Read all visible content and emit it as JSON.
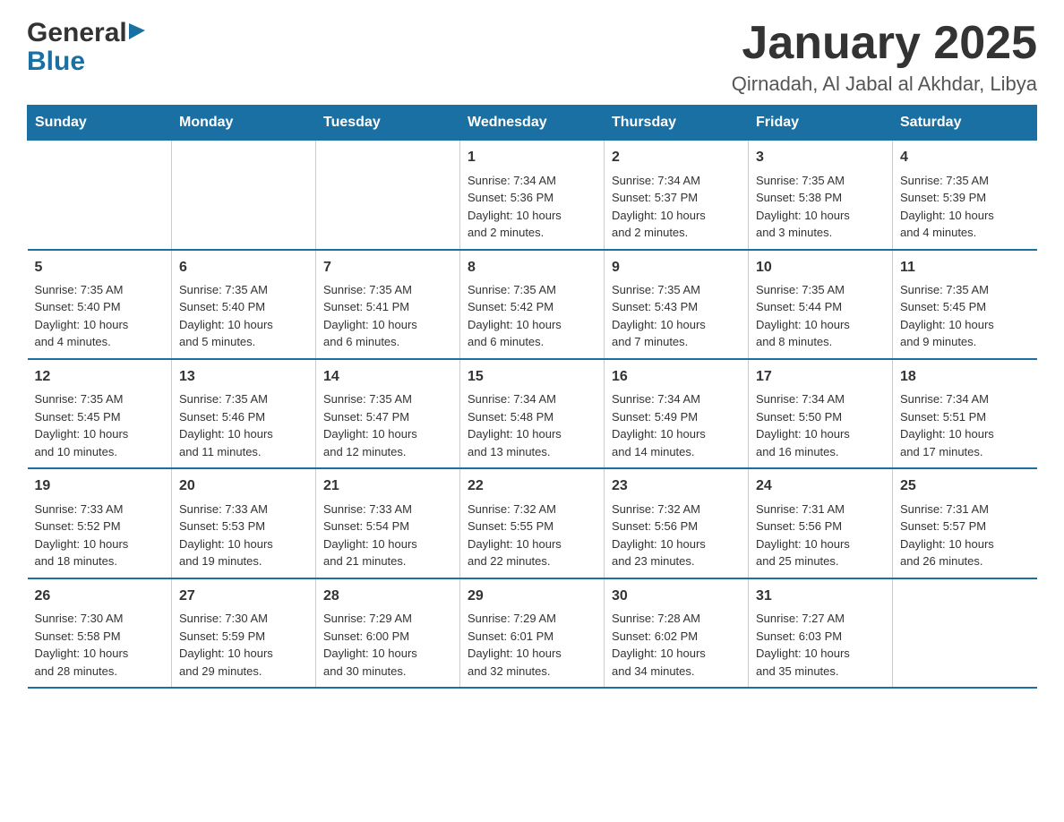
{
  "header": {
    "logo_general": "General",
    "logo_blue": "Blue",
    "month_title": "January 2025",
    "location": "Qirnadah, Al Jabal al Akhdar, Libya"
  },
  "days_of_week": [
    "Sunday",
    "Monday",
    "Tuesday",
    "Wednesday",
    "Thursday",
    "Friday",
    "Saturday"
  ],
  "weeks": [
    [
      {
        "day": "",
        "info": ""
      },
      {
        "day": "",
        "info": ""
      },
      {
        "day": "",
        "info": ""
      },
      {
        "day": "1",
        "info": "Sunrise: 7:34 AM\nSunset: 5:36 PM\nDaylight: 10 hours\nand 2 minutes."
      },
      {
        "day": "2",
        "info": "Sunrise: 7:34 AM\nSunset: 5:37 PM\nDaylight: 10 hours\nand 2 minutes."
      },
      {
        "day": "3",
        "info": "Sunrise: 7:35 AM\nSunset: 5:38 PM\nDaylight: 10 hours\nand 3 minutes."
      },
      {
        "day": "4",
        "info": "Sunrise: 7:35 AM\nSunset: 5:39 PM\nDaylight: 10 hours\nand 4 minutes."
      }
    ],
    [
      {
        "day": "5",
        "info": "Sunrise: 7:35 AM\nSunset: 5:40 PM\nDaylight: 10 hours\nand 4 minutes."
      },
      {
        "day": "6",
        "info": "Sunrise: 7:35 AM\nSunset: 5:40 PM\nDaylight: 10 hours\nand 5 minutes."
      },
      {
        "day": "7",
        "info": "Sunrise: 7:35 AM\nSunset: 5:41 PM\nDaylight: 10 hours\nand 6 minutes."
      },
      {
        "day": "8",
        "info": "Sunrise: 7:35 AM\nSunset: 5:42 PM\nDaylight: 10 hours\nand 6 minutes."
      },
      {
        "day": "9",
        "info": "Sunrise: 7:35 AM\nSunset: 5:43 PM\nDaylight: 10 hours\nand 7 minutes."
      },
      {
        "day": "10",
        "info": "Sunrise: 7:35 AM\nSunset: 5:44 PM\nDaylight: 10 hours\nand 8 minutes."
      },
      {
        "day": "11",
        "info": "Sunrise: 7:35 AM\nSunset: 5:45 PM\nDaylight: 10 hours\nand 9 minutes."
      }
    ],
    [
      {
        "day": "12",
        "info": "Sunrise: 7:35 AM\nSunset: 5:45 PM\nDaylight: 10 hours\nand 10 minutes."
      },
      {
        "day": "13",
        "info": "Sunrise: 7:35 AM\nSunset: 5:46 PM\nDaylight: 10 hours\nand 11 minutes."
      },
      {
        "day": "14",
        "info": "Sunrise: 7:35 AM\nSunset: 5:47 PM\nDaylight: 10 hours\nand 12 minutes."
      },
      {
        "day": "15",
        "info": "Sunrise: 7:34 AM\nSunset: 5:48 PM\nDaylight: 10 hours\nand 13 minutes."
      },
      {
        "day": "16",
        "info": "Sunrise: 7:34 AM\nSunset: 5:49 PM\nDaylight: 10 hours\nand 14 minutes."
      },
      {
        "day": "17",
        "info": "Sunrise: 7:34 AM\nSunset: 5:50 PM\nDaylight: 10 hours\nand 16 minutes."
      },
      {
        "day": "18",
        "info": "Sunrise: 7:34 AM\nSunset: 5:51 PM\nDaylight: 10 hours\nand 17 minutes."
      }
    ],
    [
      {
        "day": "19",
        "info": "Sunrise: 7:33 AM\nSunset: 5:52 PM\nDaylight: 10 hours\nand 18 minutes."
      },
      {
        "day": "20",
        "info": "Sunrise: 7:33 AM\nSunset: 5:53 PM\nDaylight: 10 hours\nand 19 minutes."
      },
      {
        "day": "21",
        "info": "Sunrise: 7:33 AM\nSunset: 5:54 PM\nDaylight: 10 hours\nand 21 minutes."
      },
      {
        "day": "22",
        "info": "Sunrise: 7:32 AM\nSunset: 5:55 PM\nDaylight: 10 hours\nand 22 minutes."
      },
      {
        "day": "23",
        "info": "Sunrise: 7:32 AM\nSunset: 5:56 PM\nDaylight: 10 hours\nand 23 minutes."
      },
      {
        "day": "24",
        "info": "Sunrise: 7:31 AM\nSunset: 5:56 PM\nDaylight: 10 hours\nand 25 minutes."
      },
      {
        "day": "25",
        "info": "Sunrise: 7:31 AM\nSunset: 5:57 PM\nDaylight: 10 hours\nand 26 minutes."
      }
    ],
    [
      {
        "day": "26",
        "info": "Sunrise: 7:30 AM\nSunset: 5:58 PM\nDaylight: 10 hours\nand 28 minutes."
      },
      {
        "day": "27",
        "info": "Sunrise: 7:30 AM\nSunset: 5:59 PM\nDaylight: 10 hours\nand 29 minutes."
      },
      {
        "day": "28",
        "info": "Sunrise: 7:29 AM\nSunset: 6:00 PM\nDaylight: 10 hours\nand 30 minutes."
      },
      {
        "day": "29",
        "info": "Sunrise: 7:29 AM\nSunset: 6:01 PM\nDaylight: 10 hours\nand 32 minutes."
      },
      {
        "day": "30",
        "info": "Sunrise: 7:28 AM\nSunset: 6:02 PM\nDaylight: 10 hours\nand 34 minutes."
      },
      {
        "day": "31",
        "info": "Sunrise: 7:27 AM\nSunset: 6:03 PM\nDaylight: 10 hours\nand 35 minutes."
      },
      {
        "day": "",
        "info": ""
      }
    ]
  ]
}
